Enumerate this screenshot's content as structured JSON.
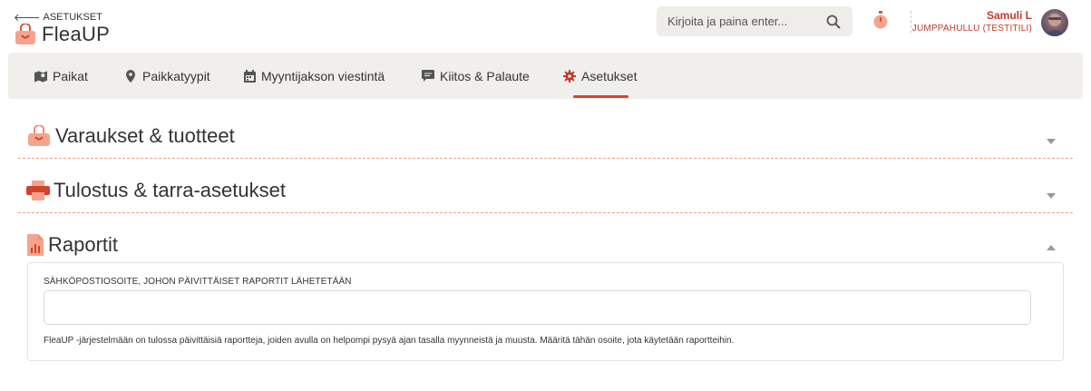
{
  "header": {
    "back_label": "ASETUKSET",
    "logo_text": "FleaUP",
    "search_placeholder": "Kirjoita ja paina enter...",
    "user_name": "Samuli L",
    "user_org": "JUMPPAHULLU (TESTITILI)"
  },
  "nav": {
    "items": [
      {
        "label": "Paikat",
        "icon": "map-icon"
      },
      {
        "label": "Paikkatyypit",
        "icon": "map-marker-icon"
      },
      {
        "label": "Myyntijakson viestintä",
        "icon": "calendar-icon"
      },
      {
        "label": "Kiitos & Palaute",
        "icon": "comment-icon"
      },
      {
        "label": "Asetukset",
        "icon": "gear-icon",
        "active": true
      }
    ]
  },
  "sections": [
    {
      "title": "Varaukset & tuotteet",
      "icon": "shopping-bag-icon",
      "expanded": false
    },
    {
      "title": "Tulostus & tarra-asetukset",
      "icon": "printer-icon",
      "expanded": false
    },
    {
      "title": "Raportit",
      "icon": "report-icon",
      "expanded": true
    }
  ],
  "reports": {
    "email_label": "SÄHKÖPOSTIOSOITE, JOHON PÄIVITTÄISET RAPORTIT LÄHETETÄÄN",
    "email_value": "",
    "help_text": "FleaUP -järjestelmään on tulossa päivittäisiä raportteja, joiden avulla on helpompi pysyä ajan tasalla myynneistä ja muusta. Määritä tähän osoite, jota käytetään raportteihin."
  },
  "colors": {
    "accent": "#d2442a",
    "section_icon": "#f08c70",
    "nav_bg": "#f1efec"
  }
}
